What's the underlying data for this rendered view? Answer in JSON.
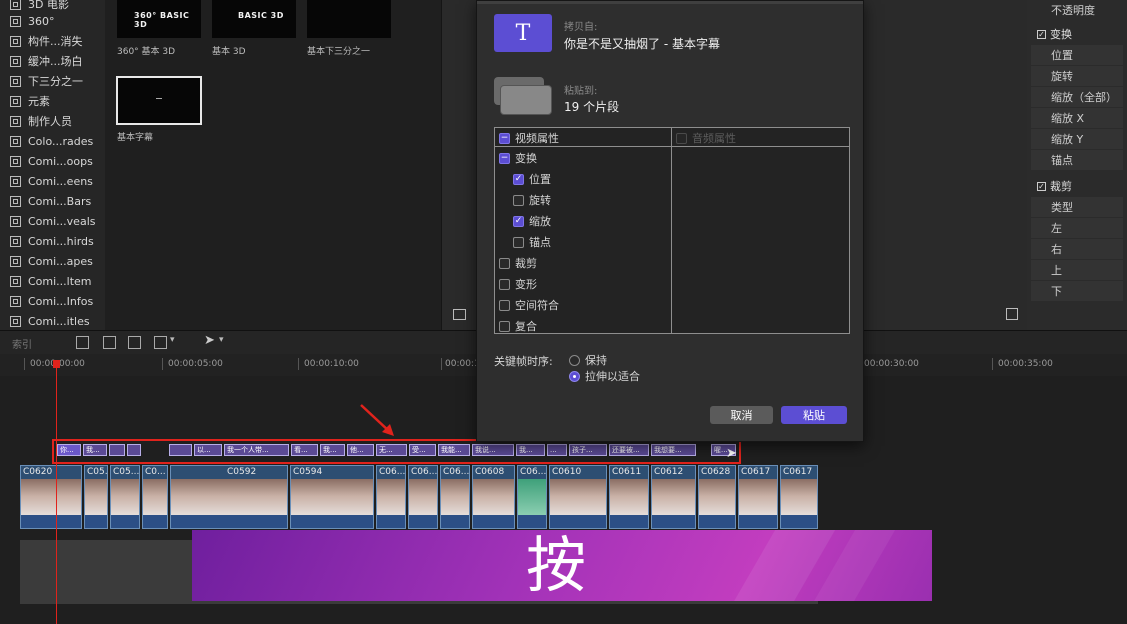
{
  "sidebar": {
    "items": [
      {
        "label": "3D 电影"
      },
      {
        "label": "360°"
      },
      {
        "label": "构件...消失"
      },
      {
        "label": "缓冲...场白"
      },
      {
        "label": "下三分之一"
      },
      {
        "label": "元素"
      },
      {
        "label": "制作人员"
      },
      {
        "label": "Colo...rades"
      },
      {
        "label": "Comi...oops"
      },
      {
        "label": "Comi...eens"
      },
      {
        "label": "Comi...Bars"
      },
      {
        "label": "Comi...veals"
      },
      {
        "label": "Comi...hirds"
      },
      {
        "label": "Comi...apes"
      },
      {
        "label": "Comi...ltem"
      },
      {
        "label": "Comi...Infos"
      },
      {
        "label": "Comi...itles"
      }
    ]
  },
  "browser": {
    "thumbs": [
      {
        "label": "360° 基本 3D",
        "title": "360° BASIC 3D"
      },
      {
        "label": "基本 3D",
        "title": "BASIC 3D"
      },
      {
        "label": "基本下三分之一",
        "title": ""
      },
      {
        "label": "基本字幕",
        "title": ""
      }
    ]
  },
  "inspector": {
    "opacity": "不透明度",
    "transform": {
      "header": "变换",
      "rows": [
        "位置",
        "旋转",
        "缩放（全部）",
        "缩放 X",
        "缩放 Y",
        "锚点"
      ]
    },
    "crop": {
      "header": "裁剪",
      "rows": [
        "类型",
        "左",
        "右",
        "上",
        "下"
      ]
    }
  },
  "toolbar": {
    "index_label": "索引"
  },
  "ruler": {
    "ticks": [
      "00:00:00:00",
      "00:00:05:00",
      "00:00:10:00",
      "00:00:1",
      "00:00:30:00",
      "00:00:35:00"
    ]
  },
  "dialog": {
    "copy_from_label": "拷贝自:",
    "copy_from_value": "你是不是又抽烟了 - 基本字幕",
    "paste_to_label": "粘贴到:",
    "paste_to_value": "19 个片段",
    "video_props": "视频属性",
    "audio_props": "音频属性",
    "props": [
      {
        "label": "变换",
        "state": "mixed"
      },
      {
        "label": "位置",
        "state": "on"
      },
      {
        "label": "旋转",
        "state": "off"
      },
      {
        "label": "缩放",
        "state": "on"
      },
      {
        "label": "锚点",
        "state": "off"
      },
      {
        "label": "裁剪",
        "state": "off"
      },
      {
        "label": "变形",
        "state": "off"
      },
      {
        "label": "空间符合",
        "state": "off"
      },
      {
        "label": "复合",
        "state": "off"
      }
    ],
    "keyframe_label": "关键帧时序:",
    "keyframe_options": [
      {
        "label": "保持",
        "selected": false
      },
      {
        "label": "拉伸以适合",
        "selected": true
      }
    ],
    "cancel_label": "取消",
    "paste_label": "粘贴"
  },
  "timeline": {
    "title_clips": [
      "你...",
      "我...",
      "",
      "",
      "",
      "以...",
      "我一个人带...",
      "看...",
      "我...",
      "他...",
      "无...",
      "受...",
      "我能...",
      "我说...",
      "我...",
      "...",
      "孩子...",
      "还要被...",
      "我想要...",
      "喔..."
    ],
    "video_clips": [
      "C0620",
      "C05...",
      "C05...",
      "C0...",
      "C0592",
      "C0594",
      "C06...",
      "C06...",
      "C06...",
      "C0608",
      "C06...",
      "C0610",
      "C0611",
      "C0612",
      "C0628",
      "C0617",
      "C0617"
    ],
    "bottom_title": "按"
  },
  "colors": {
    "accent": "#5c4ed3",
    "annotation": "#e0231c"
  }
}
